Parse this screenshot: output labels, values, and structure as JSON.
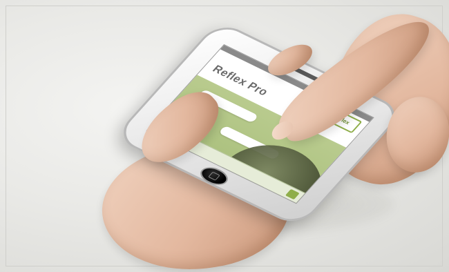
{
  "scene": {
    "description": "",
    "phone": {
      "app_title": "Reflex Pro",
      "logo_text": "reflex",
      "accent_color": "#8fae4a",
      "chat_bubbles": [
        "",
        ""
      ],
      "icons": {
        "home_button": "home-button-icon",
        "speaker": "speaker-icon",
        "camera": "camera-icon",
        "send": "send-icon"
      }
    },
    "colors": {
      "screen_green": "#b9cb8e",
      "background": "#e9e9e6",
      "skin": "#e3b89f"
    }
  }
}
